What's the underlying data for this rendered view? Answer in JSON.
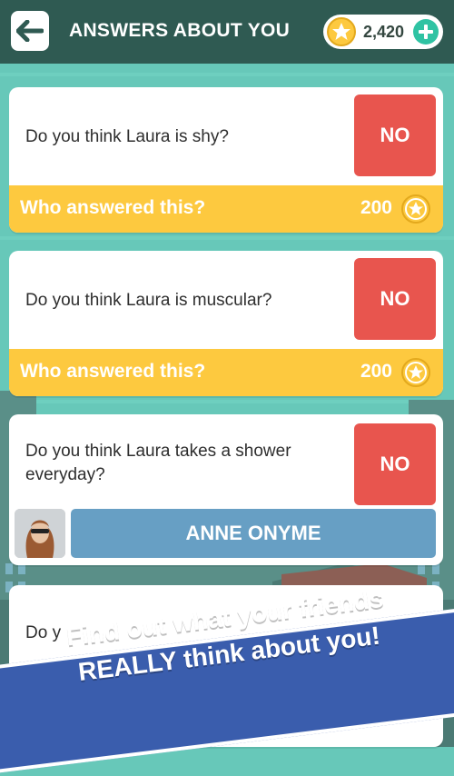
{
  "header": {
    "title": "ANSWERS ABOUT YOU",
    "coins": "2,420"
  },
  "cards": [
    {
      "question": "Do you think Laura is shy?",
      "answer": "NO",
      "who_label": "Who answered this?",
      "price": "200"
    },
    {
      "question": "Do you think Laura is muscular?",
      "answer": "NO",
      "who_label": "Who answered this?",
      "price": "200"
    },
    {
      "question": "Do you think Laura takes a shower everyday?",
      "answer": "NO",
      "answered_by": "ANNE ONYME"
    },
    {
      "question_partial": "Do y"
    }
  ],
  "banner": {
    "line1": "Find out what your friends",
    "line2": "REALLY think about you!"
  },
  "colors": {
    "header": "#2f5a52",
    "background": "#67c8b9",
    "no_button": "#e8554e",
    "who_bar": "#fdc93f",
    "name_bar": "#679fc4",
    "banner": "#3a5dad"
  },
  "icons": {
    "back": "arrow-left-icon",
    "coin": "star-coin-icon",
    "add": "plus-icon"
  }
}
